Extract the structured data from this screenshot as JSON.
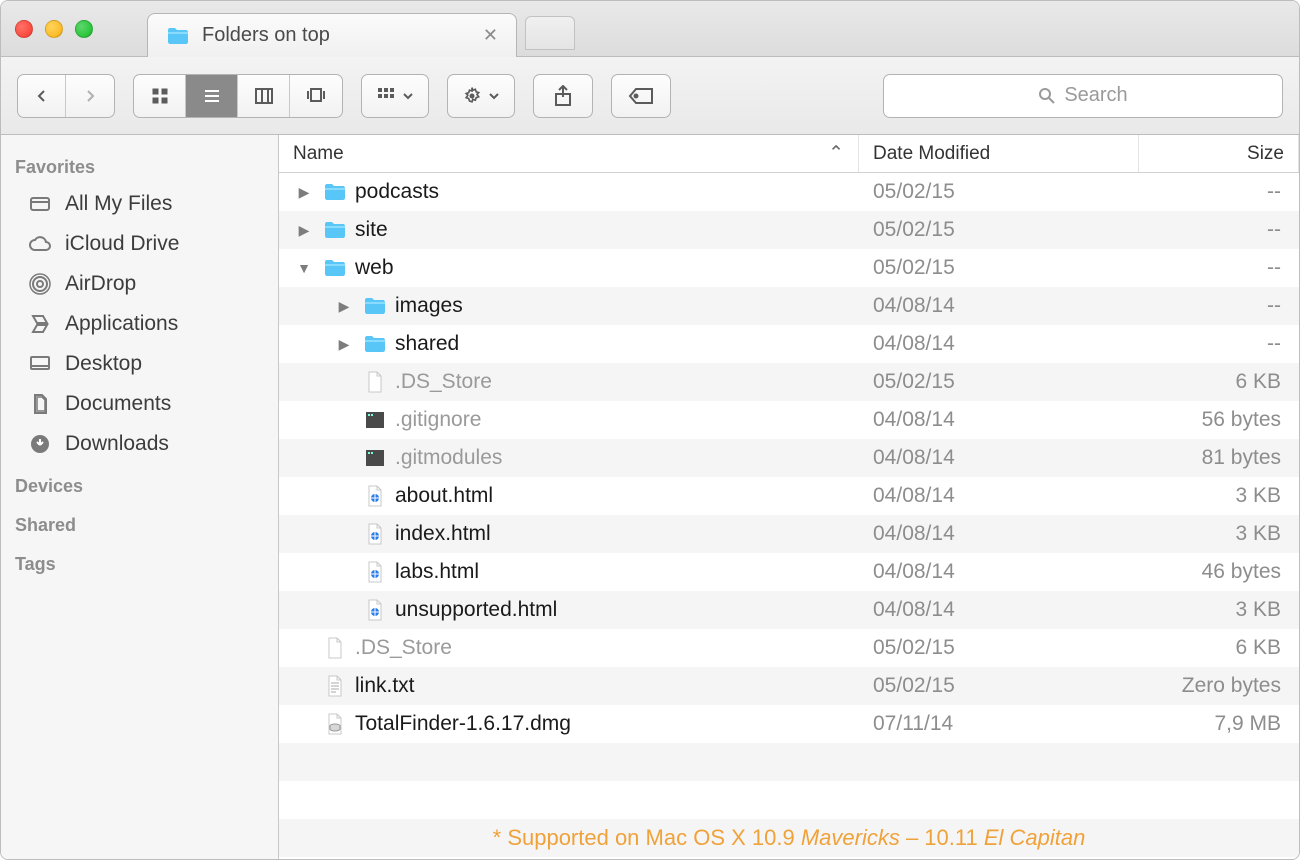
{
  "window": {
    "tab_title": "Folders on top"
  },
  "toolbar": {
    "search_placeholder": "Search"
  },
  "sidebar": {
    "sections": [
      {
        "title": "Favorites",
        "items": [
          {
            "label": "All My Files",
            "icon": "all-files-icon"
          },
          {
            "label": "iCloud Drive",
            "icon": "cloud-icon"
          },
          {
            "label": "AirDrop",
            "icon": "airdrop-icon"
          },
          {
            "label": "Applications",
            "icon": "applications-icon"
          },
          {
            "label": "Desktop",
            "icon": "desktop-icon"
          },
          {
            "label": "Documents",
            "icon": "documents-icon"
          },
          {
            "label": "Downloads",
            "icon": "downloads-icon"
          }
        ]
      },
      {
        "title": "Devices",
        "items": []
      },
      {
        "title": "Shared",
        "items": []
      },
      {
        "title": "Tags",
        "items": []
      }
    ]
  },
  "columns": {
    "name": "Name",
    "date": "Date Modified",
    "size": "Size"
  },
  "rows": [
    {
      "name": "podcasts",
      "date": "05/02/15",
      "size": "--",
      "kind": "folder",
      "indent": 0,
      "chevron": "right",
      "dim": false
    },
    {
      "name": "site",
      "date": "05/02/15",
      "size": "--",
      "kind": "folder",
      "indent": 0,
      "chevron": "right",
      "dim": false
    },
    {
      "name": "web",
      "date": "05/02/15",
      "size": "--",
      "kind": "folder",
      "indent": 0,
      "chevron": "down",
      "dim": false
    },
    {
      "name": "images",
      "date": "04/08/14",
      "size": "--",
      "kind": "folder",
      "indent": 1,
      "chevron": "right",
      "dim": false
    },
    {
      "name": "shared",
      "date": "04/08/14",
      "size": "--",
      "kind": "folder",
      "indent": 1,
      "chevron": "right",
      "dim": false
    },
    {
      "name": ".DS_Store",
      "date": "05/02/15",
      "size": "6 KB",
      "kind": "blank",
      "indent": 1,
      "chevron": "none",
      "dim": true
    },
    {
      "name": ".gitignore",
      "date": "04/08/14",
      "size": "56 bytes",
      "kind": "dark",
      "indent": 1,
      "chevron": "none",
      "dim": true
    },
    {
      "name": ".gitmodules",
      "date": "04/08/14",
      "size": "81 bytes",
      "kind": "dark",
      "indent": 1,
      "chevron": "none",
      "dim": true
    },
    {
      "name": "about.html",
      "date": "04/08/14",
      "size": "3 KB",
      "kind": "html",
      "indent": 1,
      "chevron": "none",
      "dim": false
    },
    {
      "name": "index.html",
      "date": "04/08/14",
      "size": "3 KB",
      "kind": "html",
      "indent": 1,
      "chevron": "none",
      "dim": false
    },
    {
      "name": "labs.html",
      "date": "04/08/14",
      "size": "46 bytes",
      "kind": "html",
      "indent": 1,
      "chevron": "none",
      "dim": false
    },
    {
      "name": "unsupported.html",
      "date": "04/08/14",
      "size": "3 KB",
      "kind": "html",
      "indent": 1,
      "chevron": "none",
      "dim": false
    },
    {
      "name": ".DS_Store",
      "date": "05/02/15",
      "size": "6 KB",
      "kind": "blank",
      "indent": 0,
      "chevron": "none",
      "dim": true
    },
    {
      "name": "link.txt",
      "date": "05/02/15",
      "size": "Zero bytes",
      "kind": "txt",
      "indent": 0,
      "chevron": "none",
      "dim": false
    },
    {
      "name": "TotalFinder-1.6.17.dmg",
      "date": "07/11/14",
      "size": "7,9 MB",
      "kind": "dmg",
      "indent": 0,
      "chevron": "none",
      "dim": false
    }
  ],
  "footnote": {
    "prefix": "* Supported on Mac OS X 10.9 ",
    "em1": "Mavericks",
    "mid": " – 10.11 ",
    "em2": "El Capitan"
  }
}
